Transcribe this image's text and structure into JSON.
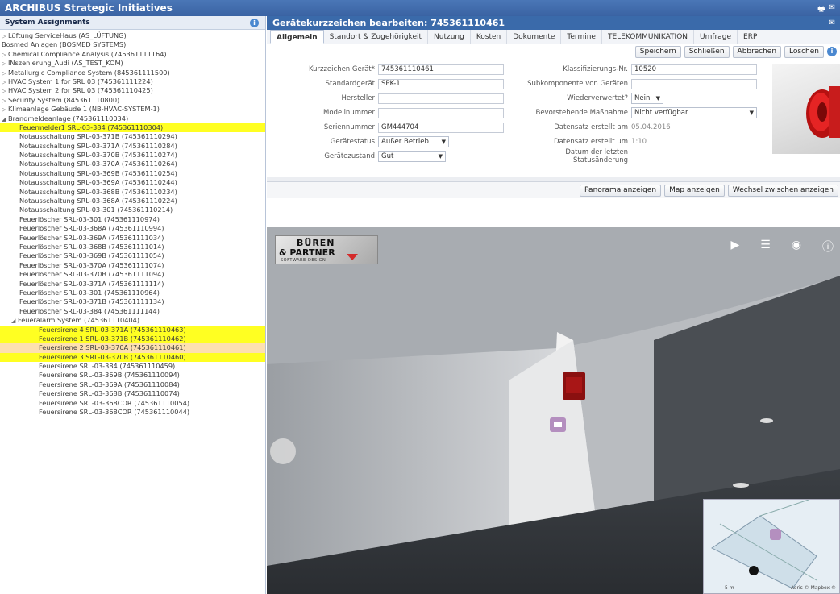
{
  "app": {
    "title": "ARCHIBUS Strategic Initiatives"
  },
  "left": {
    "header": "System Assignments",
    "items": [
      {
        "label": "Lüftung ServiceHaus (AS_LÜFTUNG)",
        "level": "lv0",
        "arrow": "▷"
      },
      {
        "label": "Bosmed Anlagen (BOSMED SYSTEMS)",
        "level": "lv0",
        "arrow": ""
      },
      {
        "label": "Chemical Compliance Analysis (745361111164)",
        "level": "lv0",
        "arrow": "▷"
      },
      {
        "label": "INszenierung_Audi (AS_TEST_KOM)",
        "level": "lv0",
        "arrow": "▷"
      },
      {
        "label": "Metallurgic Compliance System (845361111500)",
        "level": "lv0",
        "arrow": "▷"
      },
      {
        "label": "HVAC System 1 for SRL 03 (745361111224)",
        "level": "lv0",
        "arrow": "▷"
      },
      {
        "label": "HVAC System 2 for SRL 03 (745361110425)",
        "level": "lv0",
        "arrow": "▷"
      },
      {
        "label": "Security System (845361110800)",
        "level": "lv0",
        "arrow": "▷"
      },
      {
        "label": "Klimaanlage Gebäude 1 (NB-HVAC-SYSTEM-1)",
        "level": "lv0",
        "arrow": "▷"
      },
      {
        "label": "Brandmeldeanlage (745361110034)",
        "level": "lv0",
        "arrow": "◢"
      },
      {
        "label": "Feuermelder1 SRL-03-384 (745361110304)",
        "level": "lv1b",
        "arrow": "",
        "state": "hl"
      },
      {
        "label": "Notausschaltung SRL-03-371B (745361110294)",
        "level": "lv1b",
        "arrow": ""
      },
      {
        "label": "Notausschaltung SRL-03-371A (745361110284)",
        "level": "lv1b",
        "arrow": ""
      },
      {
        "label": "Notausschaltung SRL-03-370B (745361110274)",
        "level": "lv1b",
        "arrow": ""
      },
      {
        "label": "Notausschaltung SRL-03-370A (745361110264)",
        "level": "lv1b",
        "arrow": ""
      },
      {
        "label": "Notausschaltung SRL-03-369B (745361110254)",
        "level": "lv1b",
        "arrow": ""
      },
      {
        "label": "Notausschaltung SRL-03-369A (745361110244)",
        "level": "lv1b",
        "arrow": ""
      },
      {
        "label": "Notausschaltung SRL-03-368B (745361110234)",
        "level": "lv1b",
        "arrow": ""
      },
      {
        "label": "Notausschaltung SRL-03-368A (745361110224)",
        "level": "lv1b",
        "arrow": ""
      },
      {
        "label": "Notausschaltung SRL-03-301 (745361110214)",
        "level": "lv1b",
        "arrow": ""
      },
      {
        "label": "Feuerlöscher SRL-03-301 (745361110974)",
        "level": "lv1b",
        "arrow": ""
      },
      {
        "label": "Feuerlöscher SRL-03-368A (745361110994)",
        "level": "lv1b",
        "arrow": ""
      },
      {
        "label": "Feuerlöscher SRL-03-369A (745361111034)",
        "level": "lv1b",
        "arrow": ""
      },
      {
        "label": "Feuerlöscher SRL-03-368B (745361111014)",
        "level": "lv1b",
        "arrow": ""
      },
      {
        "label": "Feuerlöscher SRL-03-369B (745361111054)",
        "level": "lv1b",
        "arrow": ""
      },
      {
        "label": "Feuerlöscher SRL-03-370A (745361111074)",
        "level": "lv1b",
        "arrow": ""
      },
      {
        "label": "Feuerlöscher SRL-03-370B (745361111094)",
        "level": "lv1b",
        "arrow": ""
      },
      {
        "label": "Feuerlöscher SRL-03-371A (745361111114)",
        "level": "lv1b",
        "arrow": ""
      },
      {
        "label": "Feuerlöscher SRL-03-301 (745361110964)",
        "level": "lv1b",
        "arrow": ""
      },
      {
        "label": "Feuerlöscher SRL-03-371B (745361111134)",
        "level": "lv1b",
        "arrow": ""
      },
      {
        "label": "Feuerlöscher SRL-03-384 (745361111144)",
        "level": "lv1b",
        "arrow": ""
      },
      {
        "label": "Feueralarm System (745361110404)",
        "level": "lv1",
        "arrow": "◢"
      },
      {
        "label": "Feuersirene 4 SRL-03-371A (745361110463)",
        "level": "lv2x",
        "arrow": "",
        "state": "hl"
      },
      {
        "label": "Feuersirene 1 SRL-03-371B (745361110462)",
        "level": "lv2x",
        "arrow": "",
        "state": "hl"
      },
      {
        "label": "Feuersirene 2 SRL-03-370A (745361110461)",
        "level": "lv2x",
        "arrow": "",
        "state": "sel"
      },
      {
        "label": "Feuersirene 3 SRL-03-370B (745361110460)",
        "level": "lv2x",
        "arrow": "",
        "state": "hl"
      },
      {
        "label": "Feuersirene SRL-03-384 (745361110459)",
        "level": "lv2x",
        "arrow": ""
      },
      {
        "label": "Feuersirene SRL-03-369B (745361110094)",
        "level": "lv2x",
        "arrow": ""
      },
      {
        "label": "Feuersirene SRL-03-369A (745361110084)",
        "level": "lv2x",
        "arrow": ""
      },
      {
        "label": "Feuersirene SRL-03-368B (745361110074)",
        "level": "lv2x",
        "arrow": ""
      },
      {
        "label": "Feuersirene SRL-03-368COR (745361110054)",
        "level": "lv2x",
        "arrow": ""
      },
      {
        "label": "Feuersirene SRL-03-368COR (745361110044)",
        "level": "lv2x",
        "arrow": ""
      }
    ]
  },
  "form": {
    "title": "Gerätekurzzeichen bearbeiten: 745361110461",
    "tabs": [
      "Allgemein",
      "Standort & Zugehörigkeit",
      "Nutzung",
      "Kosten",
      "Dokumente",
      "Termine",
      "TELEKOMMUNIKATION",
      "Umfrage",
      "ERP"
    ],
    "buttons": {
      "save": "Speichern",
      "close": "Schließen",
      "cancel": "Abbrechen",
      "delete": "Löschen"
    },
    "fields": {
      "kurzzeichen": {
        "label": "Kurzzeichen Gerät*",
        "value": "745361110461"
      },
      "standardgeraet": {
        "label": "Standardgerät",
        "value": "SPK-1"
      },
      "hersteller": {
        "label": "Hersteller",
        "value": ""
      },
      "modellnummer": {
        "label": "Modellnummer",
        "value": ""
      },
      "seriennummer": {
        "label": "Seriennummer",
        "value": "GM444704"
      },
      "geraetestatus": {
        "label": "Gerätestatus",
        "value": "Außer Betrieb"
      },
      "geraetezustand": {
        "label": "Gerätezustand",
        "value": "Gut"
      },
      "klassifizierung": {
        "label": "Klassifizierungs-Nr.",
        "value": "10520"
      },
      "subkomponente": {
        "label": "Subkomponente von Geräten",
        "value": ""
      },
      "wiederverwertet": {
        "label": "Wiederverwertet?",
        "value": "Nein"
      },
      "massnahme": {
        "label": "Bevorstehende Maßnahme",
        "value": "Nicht verfügbar"
      },
      "erstellt_am": {
        "label": "Datensatz erstellt am",
        "value": "05.04.2016"
      },
      "erstellt_um": {
        "label": "Datensatz erstellt um",
        "value": "1:10"
      },
      "statusaenderung": {
        "label": "Datum der letzten Statusänderung",
        "value": ""
      }
    }
  },
  "pano": {
    "buttons": {
      "panorama": "Panorama anzeigen",
      "map": "Map anzeigen",
      "toggle": "Wechsel zwischen anzeigen"
    },
    "logo": {
      "line1": "BÜREN",
      "line2": "& PARTNER",
      "line3": "SOFTWARE-DESIGN"
    },
    "map": {
      "scale": "5 m",
      "attribution": "Aeris © Mapbox ©"
    }
  },
  "colors": {
    "appbar": "#3a63a3",
    "highlight": "#ffff22",
    "selected": "#fde0b0"
  }
}
